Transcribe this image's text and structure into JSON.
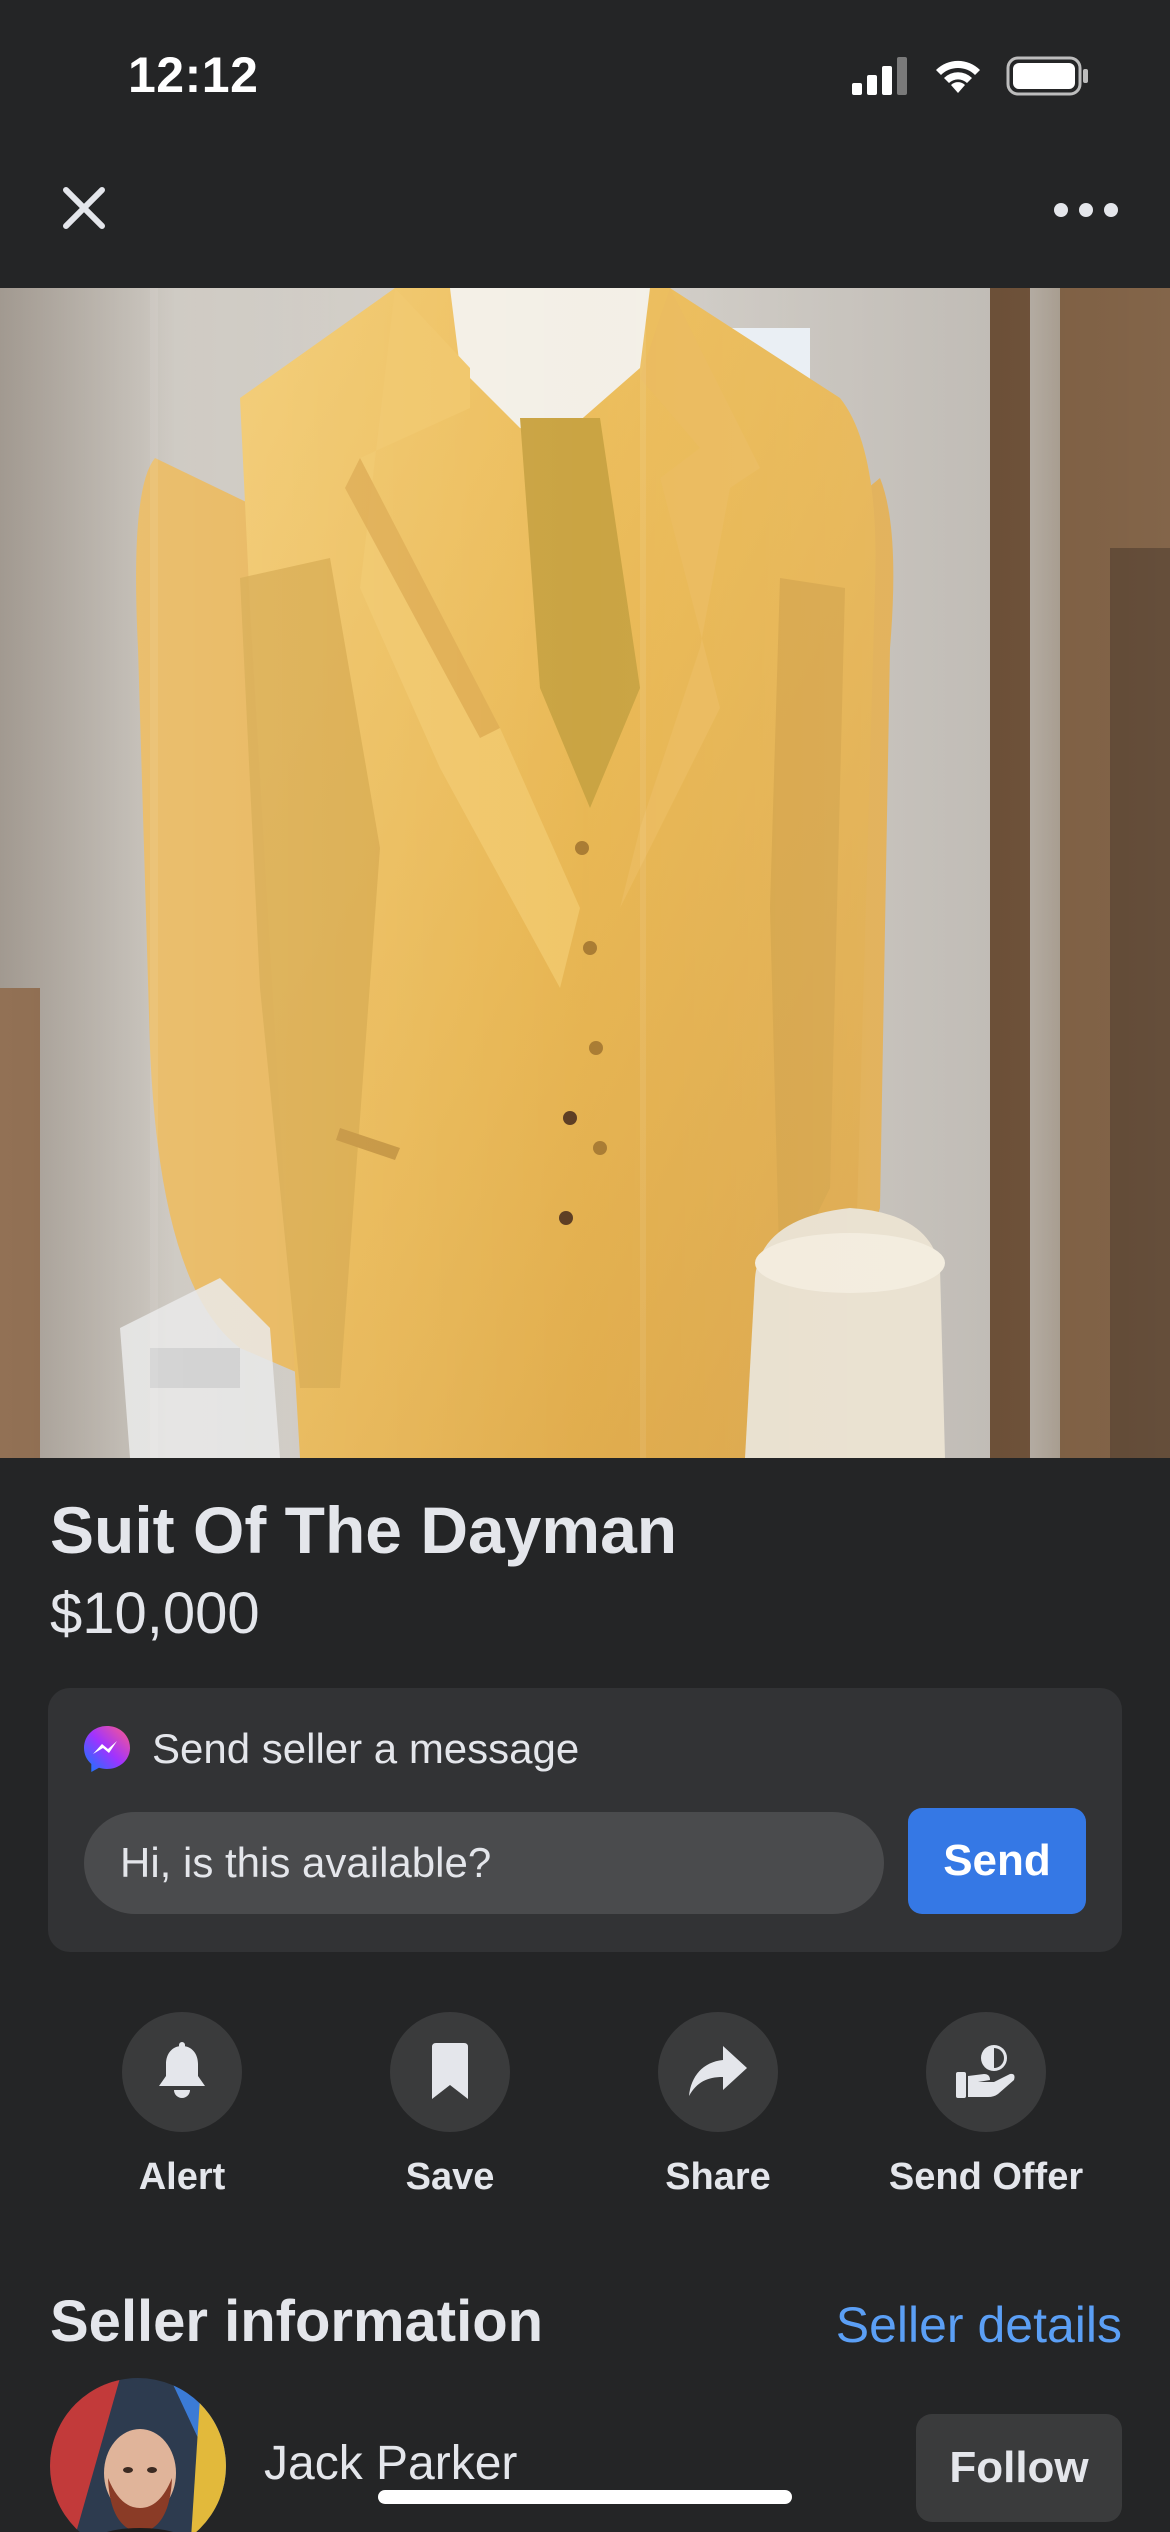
{
  "status_bar": {
    "time": "12:12",
    "icons": [
      "cellular-signal-icon",
      "wifi-icon",
      "battery-icon"
    ]
  },
  "nav": {
    "close_icon": "close-icon",
    "more_icon": "more-options-icon"
  },
  "listing": {
    "title": "Suit Of The Dayman",
    "price": "$10,000"
  },
  "message": {
    "header": "Send seller a message",
    "icon": "messenger-icon",
    "input_value": "Hi, is this available?",
    "send_label": "Send"
  },
  "actions": [
    {
      "label": "Alert",
      "icon": "bell-icon"
    },
    {
      "label": "Save",
      "icon": "bookmark-icon"
    },
    {
      "label": "Share",
      "icon": "share-arrow-icon"
    },
    {
      "label": "Send Offer",
      "icon": "offer-hand-icon"
    }
  ],
  "seller": {
    "heading": "Seller information",
    "details_link": "Seller details",
    "name": "Jack Parker",
    "follow_label": "Follow"
  },
  "colors": {
    "background": "#242526",
    "card": "#323335",
    "accent": "#3578e5",
    "link": "#5b9ff5"
  }
}
